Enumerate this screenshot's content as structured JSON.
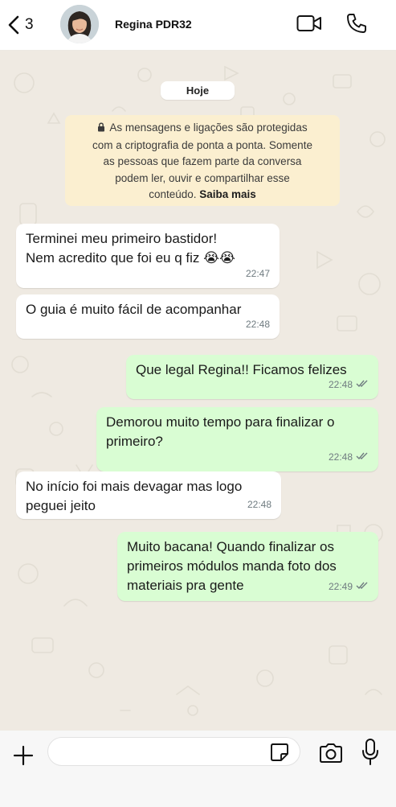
{
  "header": {
    "back_count": "3",
    "contact_name": "Regina PDR32",
    "icons": {
      "back": "chevron-left-icon",
      "video": "video-camera-icon",
      "call": "phone-icon"
    }
  },
  "chat": {
    "date_label": "Hoje",
    "encryption_notice": {
      "line1": "As mensagens e ligações são protegidas",
      "line2": "com a criptografia de ponta a ponta. Somente",
      "line3": "as pessoas que fazem parte da conversa",
      "line4": "podem ler, ouvir e compartilhar esse",
      "line5_text": "conteúdo.",
      "learn_more": "Saiba mais"
    },
    "messages": [
      {
        "direction": "in",
        "text": "Terminei meu primeiro bastidor!\nNem acredito que foi eu q fiz 😭😭",
        "time": "22:47"
      },
      {
        "direction": "in",
        "text": "O guia é muito fácil de acompanhar",
        "time": "22:48"
      },
      {
        "direction": "out",
        "text": "Que legal Regina!! Ficamos felizes",
        "time": "22:48"
      },
      {
        "direction": "out",
        "text": "Demorou muito tempo para finalizar o\nprimeiro?",
        "time": "22:48"
      },
      {
        "direction": "in",
        "text": "No início foi mais devagar mas logo\npeguei jeito",
        "time": "22:48"
      },
      {
        "direction": "out",
        "text": "Muito bacana! Quando finalizar os\nprimeiros módulos manda foto dos\nmateriais pra gente",
        "time": "22:49"
      }
    ]
  },
  "composer": {
    "message_value": "",
    "icons": {
      "attach": "plus-icon",
      "sticker": "sticker-icon",
      "camera": "camera-icon",
      "mic": "microphone-icon"
    }
  },
  "colors": {
    "incoming_bubble": "#ffffff",
    "outgoing_bubble": "#d9fdd3",
    "chat_background": "#efeae2",
    "notice_background": "#fbefd0",
    "read_ticks": "#6f7b80"
  }
}
